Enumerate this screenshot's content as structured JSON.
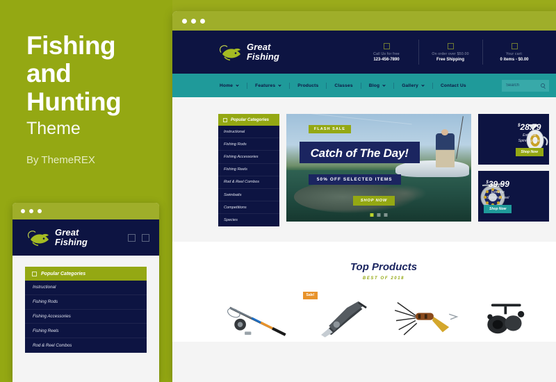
{
  "promo": {
    "title_line1": "Fishing",
    "title_line2": "and",
    "title_line3": "Hunting",
    "subtitle": "Theme",
    "author": "By ThemeREX",
    "bg_color": "#94a813"
  },
  "window": {
    "titlebar_color": "#9fae2a",
    "dot_count": 3
  },
  "site": {
    "logo": {
      "name": "Great Fishing",
      "line1": "Great",
      "line2": "Fishing",
      "icon": "fish-logo-icon"
    },
    "header_info": [
      {
        "icon": "phone-icon",
        "top": "Call Us for free",
        "bottom": "123-456-7890"
      },
      {
        "icon": "truck-icon",
        "top": "On order over $50.00",
        "bottom": "Free Shipping"
      },
      {
        "icon": "cart-icon",
        "top": "Your cart:",
        "bottom": "0 items - $0.00"
      }
    ],
    "nav": [
      {
        "label": "Home",
        "has_dropdown": true,
        "active": true
      },
      {
        "label": "Features",
        "has_dropdown": true,
        "active": false
      },
      {
        "label": "Products",
        "has_dropdown": false,
        "active": false
      },
      {
        "label": "Classes",
        "has_dropdown": false,
        "active": false
      },
      {
        "label": "Blog",
        "has_dropdown": true,
        "active": false
      },
      {
        "label": "Gallery",
        "has_dropdown": true,
        "active": false
      },
      {
        "label": "Contact Us",
        "has_dropdown": false,
        "active": false
      }
    ],
    "search": {
      "placeholder": "Search",
      "icon": "search-icon"
    },
    "nav_bg": "#1f9a9a",
    "header_bg": "#0d1442"
  },
  "categories_widget": {
    "title": "Popular Categories",
    "icon": "list-icon",
    "items": [
      "Instructional",
      "Fishing Rods",
      "Fishing Accessories",
      "Fishing Reels",
      "Rod & Reel Combos",
      "Swimbaits",
      "Competitions",
      "Species"
    ]
  },
  "hero": {
    "badge": "FLASH SALE",
    "title": "Catch of The Day!",
    "subtitle": "50% OFF SELECTED ITEMS",
    "cta": "SHOP NOW",
    "slide_count": 3,
    "active_slide": 1
  },
  "promo_cards": [
    {
      "price": "28.79",
      "currency": "$",
      "desc_line1": "Extreme",
      "desc_line2": "Spinning Reel",
      "button": "Shop Now",
      "button_color": "#94a813",
      "image_side": "right",
      "icon": "spinning-reel-icon"
    },
    {
      "price": "39.99",
      "currency": "$",
      "desc_line1": "Extreme",
      "desc_line2": "Spinning Reel",
      "button": "Shop Now",
      "button_color": "#1f9a9a",
      "image_side": "left",
      "icon": "fly-reel-icon"
    }
  ],
  "top_products": {
    "title": "Top Products",
    "subtitle": "BEST OF 2018",
    "items": [
      {
        "icon": "fishing-rod-icon",
        "badge": ""
      },
      {
        "icon": "pliers-icon",
        "badge": "Sale!"
      },
      {
        "icon": "fishing-lure-icon",
        "badge": ""
      },
      {
        "icon": "fishing-reel-icon",
        "badge": ""
      }
    ]
  },
  "tablet": {
    "icons": [
      "menu-icon",
      "cart-icon"
    ]
  }
}
